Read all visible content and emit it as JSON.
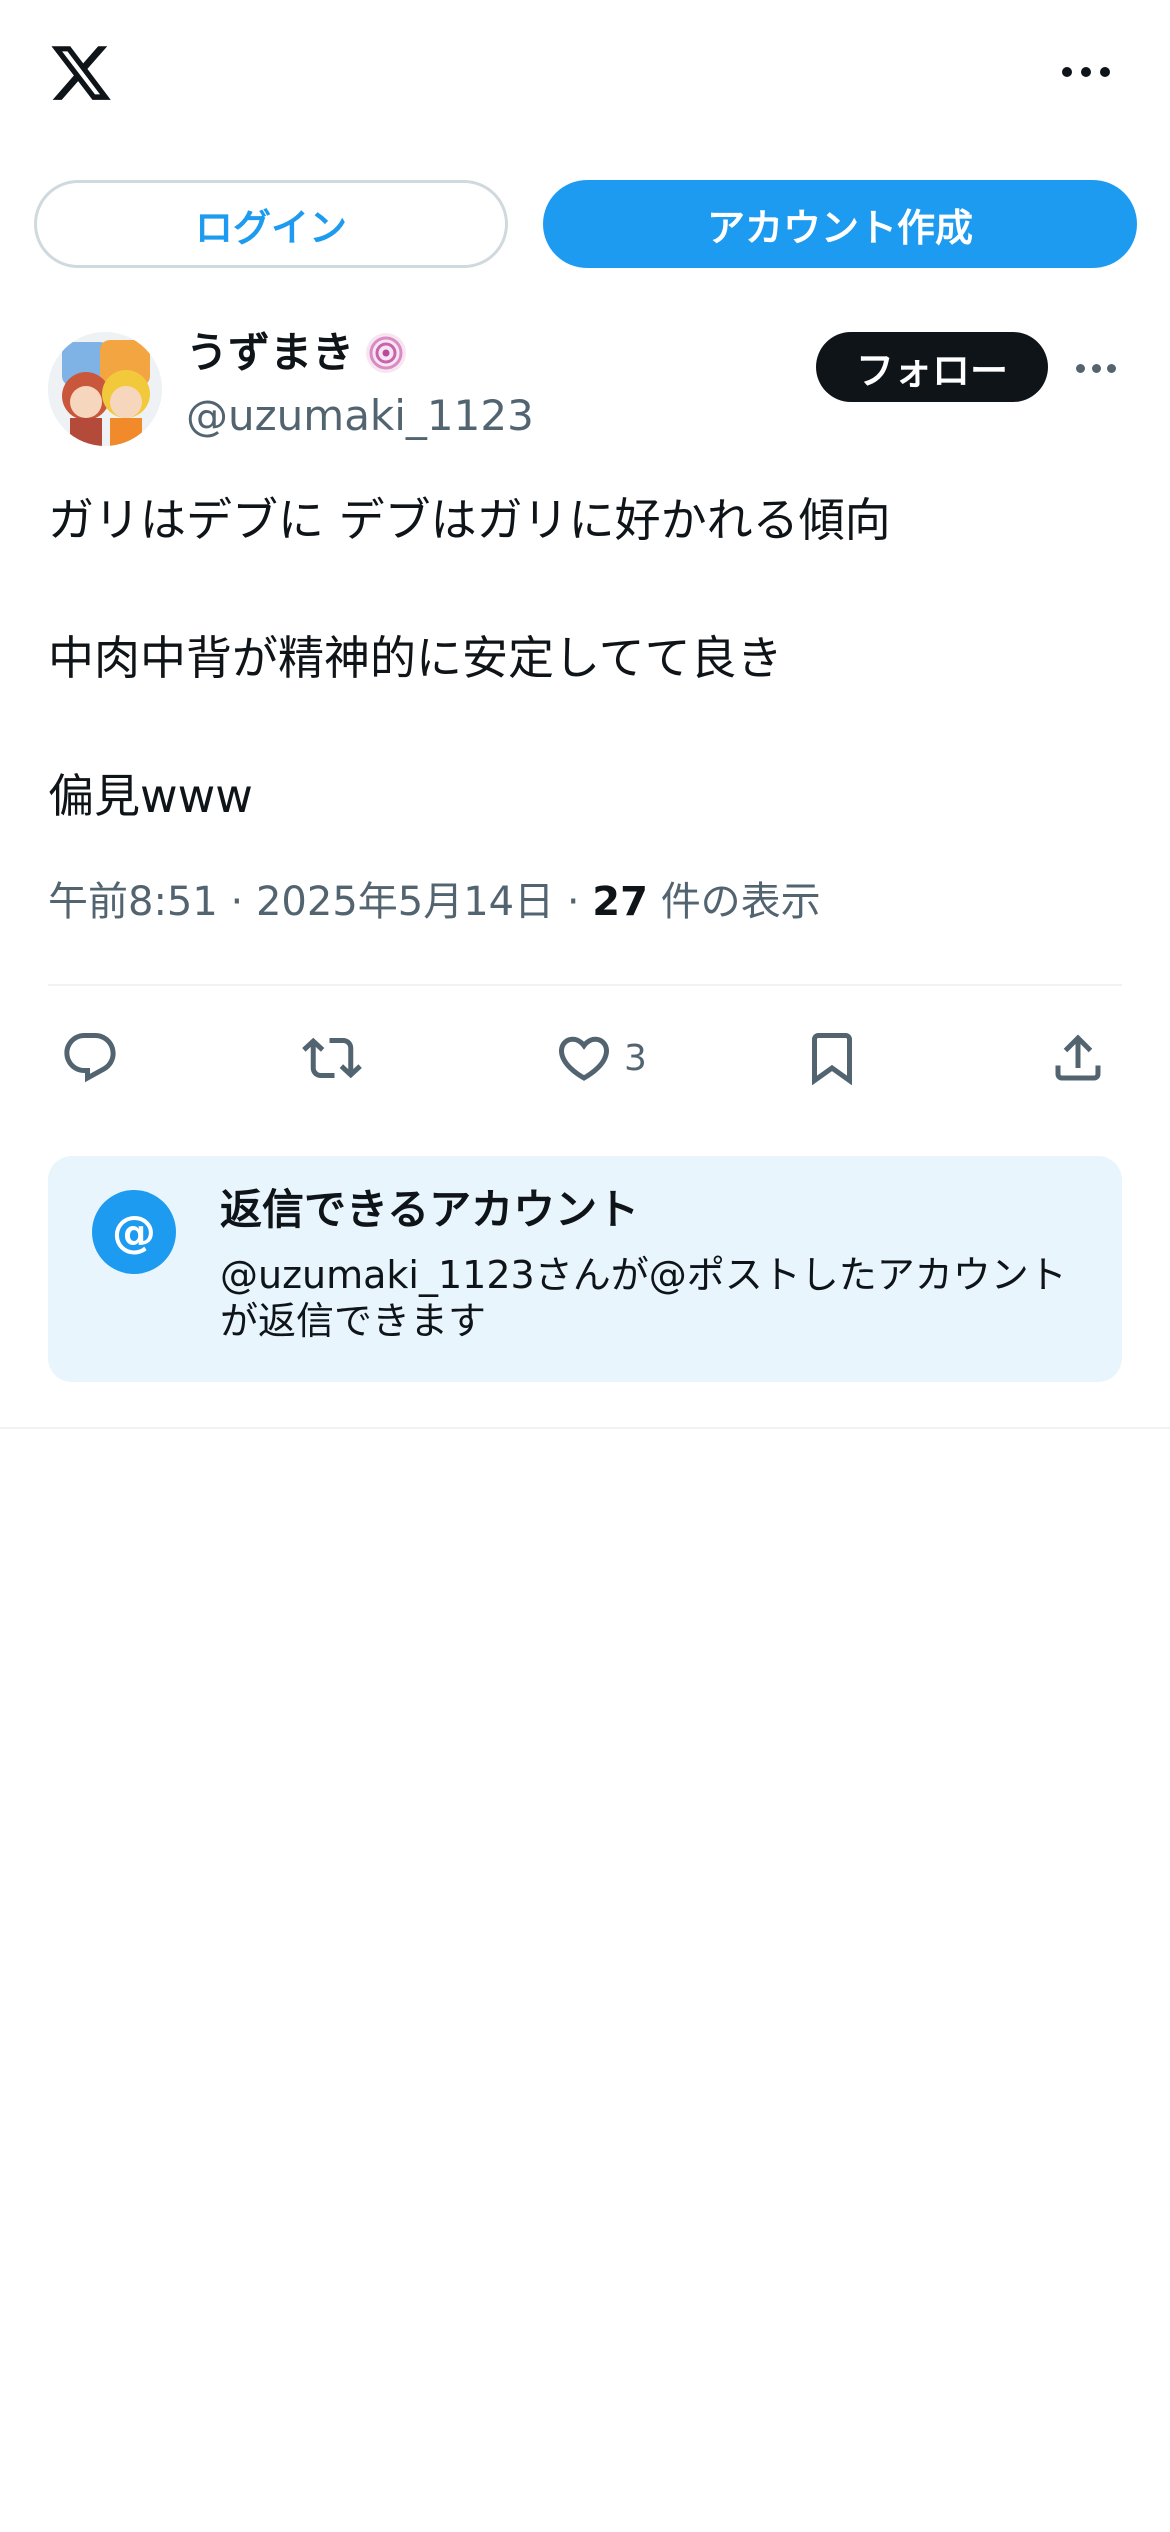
{
  "header": {
    "logo_icon": "x-logo-icon",
    "more_icon": "more-horizontal-icon",
    "login_label": "ログイン",
    "signup_label": "アカウント作成"
  },
  "post": {
    "author": {
      "display_name": "うずまき",
      "handle": "@uzumaki_1123",
      "follow_label": "フォロー",
      "badge_icon": "spiral-emoji-icon"
    },
    "text_lines": [
      "ガリはデブに デブはガリに好かれる傾向",
      "中肉中背が精神的に安定してて良き",
      "偏見www"
    ],
    "meta": {
      "time": "午前8:51",
      "sep": "·",
      "date": "2025年5月14日",
      "views_count": "27",
      "views_label": "件の表示"
    },
    "actions": {
      "reply_icon": "reply-icon",
      "repost_icon": "repost-icon",
      "like_icon": "heart-icon",
      "like_count": "3",
      "bookmark_icon": "bookmark-icon",
      "share_icon": "share-icon"
    }
  },
  "reply_restriction": {
    "icon": "at-icon",
    "at_symbol": "@",
    "title": "返信できるアカウント",
    "description": "@uzumaki_1123さんが@ポストしたアカウントが返信できます"
  },
  "colors": {
    "accent": "#1d9bf0",
    "text": "#0f1419",
    "secondary": "#536471",
    "card_bg": "#e8f5fd"
  }
}
